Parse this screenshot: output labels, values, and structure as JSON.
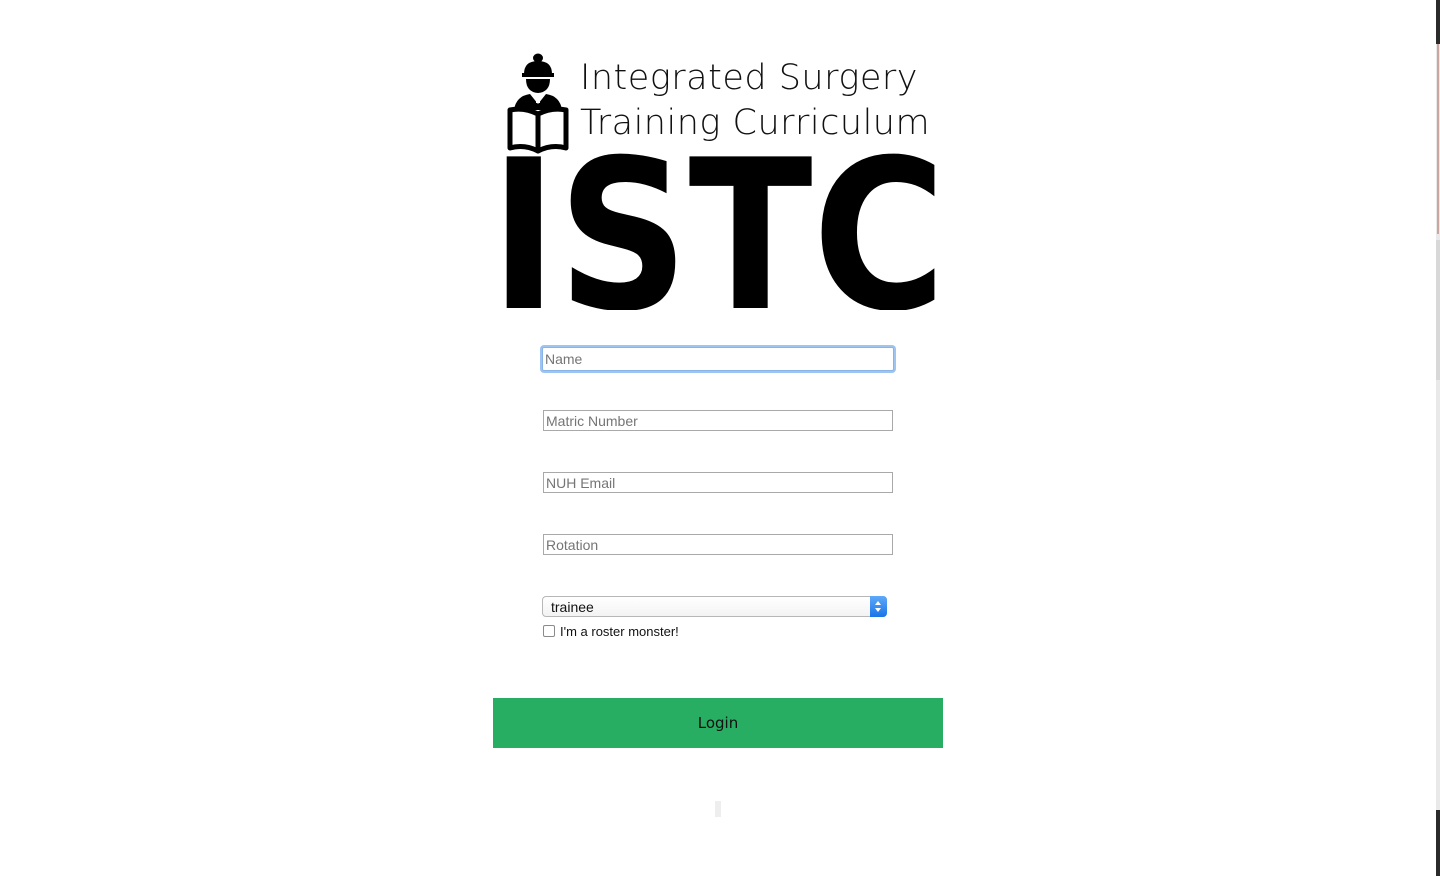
{
  "logo": {
    "tagline_line1": "Integrated Surgery",
    "tagline_line2": "Training Curriculum",
    "wordmark": "ISTC",
    "icon": "surgeon-reading-book-icon"
  },
  "form": {
    "name_placeholder": "Name",
    "matric_placeholder": "Matric Number",
    "email_placeholder": "NUH Email",
    "rotation_placeholder": "Rotation",
    "role_select": {
      "selected": "trainee"
    },
    "roster_checkbox_label": "I'm a roster monster!",
    "roster_checked": false,
    "login_label": "Login"
  },
  "colors": {
    "login_button": "#28ae62",
    "focus_ring": "#9ec5f2",
    "select_accent": "#1a73e8"
  }
}
